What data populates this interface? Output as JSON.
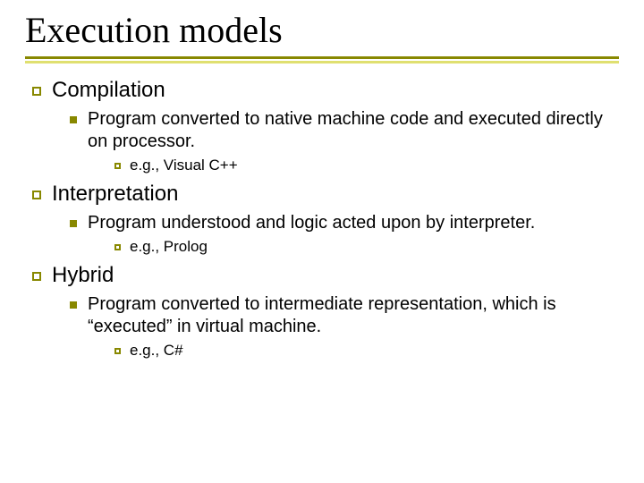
{
  "title": "Execution models",
  "items": [
    {
      "heading": "Compilation",
      "body": "Program converted to native machine code and executed directly on processor.",
      "example": "e.g., Visual C++"
    },
    {
      "heading": "Interpretation",
      "body": "Program understood and logic acted upon by interpreter.",
      "example": "e.g., Prolog"
    },
    {
      "heading": "Hybrid",
      "body": "Program converted to intermediate representation, which is “executed” in virtual machine.",
      "example": "e.g., C#"
    }
  ]
}
